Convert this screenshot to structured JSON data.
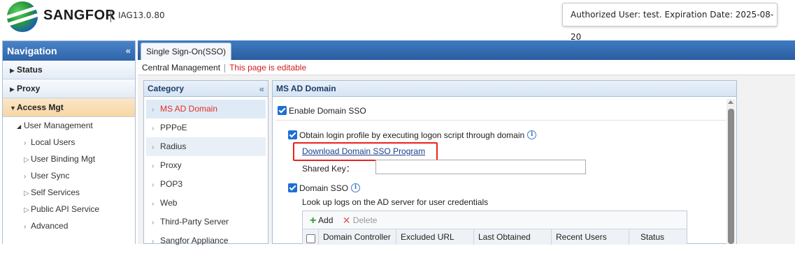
{
  "header": {
    "brand": "SANGFOR",
    "version": "IAG13.0.80",
    "auth_text": "Authorized User: test. Expiration Date: 2025-08-20"
  },
  "nav": {
    "title": "Navigation",
    "collapse": "«",
    "sections": [
      {
        "label": "Status"
      },
      {
        "label": "Proxy"
      },
      {
        "label": "Access Mgt"
      }
    ],
    "group": "User Management",
    "items": [
      {
        "label": "Local Users",
        "marker": "›"
      },
      {
        "label": "User Binding Mgt",
        "marker": "▷"
      },
      {
        "label": "User Sync",
        "marker": "›"
      },
      {
        "label": "Self Services",
        "marker": "▷"
      },
      {
        "label": "Public API Service",
        "marker": "▷"
      },
      {
        "label": "Advanced",
        "marker": "›"
      }
    ]
  },
  "tabs": [
    {
      "label": "Single Sign-On(SSO)"
    }
  ],
  "mgmt": {
    "central": "Central Management",
    "editable": "This page is editable"
  },
  "category": {
    "title": "Category",
    "collapse": "«",
    "items": [
      {
        "label": "MS AD Domain"
      },
      {
        "label": "PPPoE"
      },
      {
        "label": "Radius"
      },
      {
        "label": "Proxy"
      },
      {
        "label": "POP3"
      },
      {
        "label": "Web"
      },
      {
        "label": "Third-Party Server"
      },
      {
        "label": "Sangfor Appliance"
      }
    ]
  },
  "content": {
    "title": "MS AD Domain",
    "enable_label": "Enable Domain SSO",
    "obtain_label": "Obtain login profile by executing logon script through domain",
    "download_link": "Download Domain SSO Program",
    "shared_key_label": "Shared Key：",
    "shared_key_value": "",
    "domain_sso_label": "Domain SSO",
    "lookup_text": "Look up logs on the AD server for user credentials",
    "add_label": "Add",
    "delete_label": "Delete",
    "columns": [
      "Domain Controller",
      "Excluded URL",
      "Last Obtained",
      "Recent Users",
      "Status"
    ]
  },
  "colors": {
    "accent": "#2f64a8",
    "warning_red": "#e8231e",
    "selected_text": "#e0301e"
  }
}
